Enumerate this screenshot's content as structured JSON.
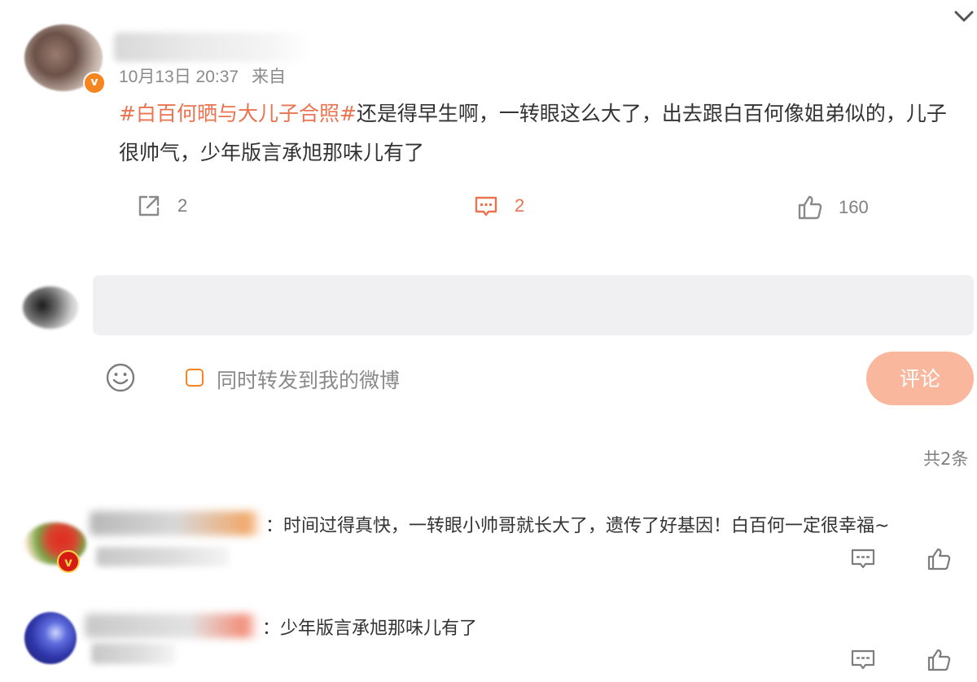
{
  "post": {
    "time": "10月13日 20:37",
    "source": "来自",
    "hashtag": "#白百何晒与大儿子合照#",
    "text": "还是得早生啊，一转眼这么大了，出去跟白百何像姐弟似的，儿子很帅气，少年版言承旭那味儿有了",
    "verified_badge": "v",
    "colors": {
      "accent": "#eb7350",
      "badge": "#f6841f"
    }
  },
  "actions": {
    "share_count": "2",
    "comment_count": "2",
    "like_count": "160"
  },
  "composer": {
    "input_value": "",
    "repost_label": "同时转发到我的微博",
    "submit_label": "评论"
  },
  "comments_summary": {
    "total": "共2条"
  },
  "comments": [
    {
      "badge": "v",
      "text": "：时间过得真快，一转眼小帅哥就长大了，遗传了好基因！白百何一定很幸福~"
    },
    {
      "text": "：少年版言承旭那味儿有了"
    }
  ],
  "icons": {
    "collapse": "chevron-down-icon",
    "share": "share-icon",
    "comment": "comment-icon",
    "like": "thumbs-up-icon",
    "emoji": "smiley-icon"
  }
}
